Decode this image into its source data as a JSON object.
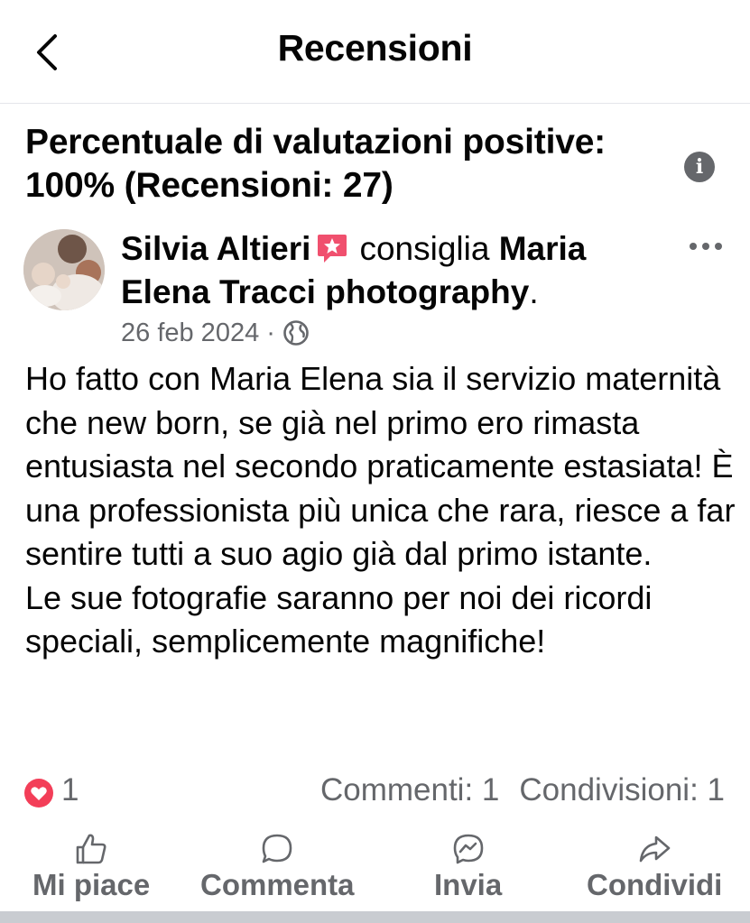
{
  "header": {
    "title": "Recensioni"
  },
  "summary": {
    "text": "Percentuale di valutazioni positive: 100% (Recensioni: 27)"
  },
  "post": {
    "author": "Silvia Altieri",
    "verb": "consiglia",
    "page": "Maria Elena Tracci photography",
    "period": ".",
    "date": "26 feb 2024",
    "separator": "·",
    "body": "Ho fatto con Maria Elena sia il servizio maternità che new born, se già nel primo ero rimasta entusiasta nel secondo praticamente estasiata! È una professionista più unica che rara, riesce a far sentire tutti a suo agio già dal primo istante.\nLe sue fotografie saranno per noi dei ricordi speciali, semplicemente magnifiche!",
    "reactions": "1",
    "comments": "Commenti: 1",
    "shares": "Condivisioni: 1"
  },
  "actions": {
    "like": "Mi piace",
    "comment": "Commenta",
    "send": "Invia",
    "share": "Condividi"
  },
  "icons": {
    "back": "chevron-left-icon",
    "info": "info-icon",
    "recommend": "recommendation-badge-icon",
    "more": "more-dots-icon",
    "privacy": "globe-icon",
    "reaction": "love-reaction-icon",
    "like": "thumbs-up-icon",
    "comment": "comment-bubble-icon",
    "send": "messenger-icon",
    "share": "share-arrow-icon"
  },
  "colors": {
    "text": "#050505",
    "secondary": "#65676b",
    "recommend_badge": "#f0506e",
    "love": "#f33e58",
    "divider": "#e4e6eb"
  }
}
